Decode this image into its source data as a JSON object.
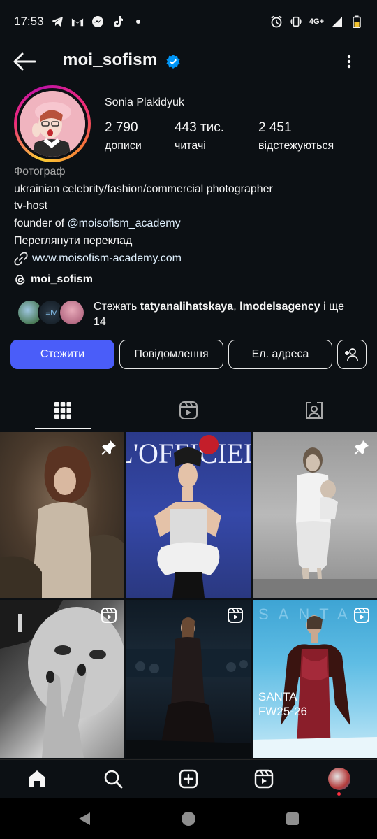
{
  "status_bar": {
    "time": "17:53",
    "network": "4G+",
    "left_icons": [
      "telegram-icon",
      "gmail-icon",
      "messenger-icon",
      "tiktok-icon",
      "dot-icon"
    ],
    "right_icons": [
      "alarm-icon",
      "vibrate-icon",
      "signal-icon",
      "battery-icon"
    ]
  },
  "header": {
    "username": "moi_sofism",
    "verified": true
  },
  "profile": {
    "full_name": "Sonia Plakidyuk",
    "stats": [
      {
        "value": "2 790",
        "label": "дописи"
      },
      {
        "value": "443 тис.",
        "label": "читачі"
      },
      {
        "value": "2 451",
        "label": "відстежуються"
      }
    ],
    "category": "Фотограф",
    "bio_line1": "ukrainian celebrity/fashion/commercial photographer",
    "bio_line2": "tv-host",
    "bio_line3_prefix": "founder of ",
    "bio_line3_mention": "@moisofism_academy",
    "translate": "Переглянути переклад",
    "link": "www.moisofism-academy.com",
    "threads_handle": "moi_sofism"
  },
  "followed_by": {
    "prefix": "Стежать ",
    "user1": "tatyanalihatskaya",
    "separator": ", ",
    "user2": "lmodelsagency",
    "suffix": " і ще",
    "count": "14"
  },
  "buttons": {
    "follow": "Стежити",
    "message": "Повідомлення",
    "email": "Ел. адреса"
  },
  "tabs": [
    "grid-icon",
    "reels-icon",
    "tagged-icon"
  ],
  "grid": {
    "cells": [
      {
        "type": "pinned"
      },
      {
        "type": "post",
        "text": "L'OFFICIEL"
      },
      {
        "type": "pinned"
      },
      {
        "type": "reel"
      },
      {
        "type": "reel"
      },
      {
        "type": "reel",
        "text_line1": "SANTA",
        "text_line2": "FW25-26",
        "brand": "SANTA"
      }
    ]
  },
  "bottom_nav": [
    "home-icon",
    "search-icon",
    "create-icon",
    "reels-icon",
    "profile-avatar"
  ]
}
